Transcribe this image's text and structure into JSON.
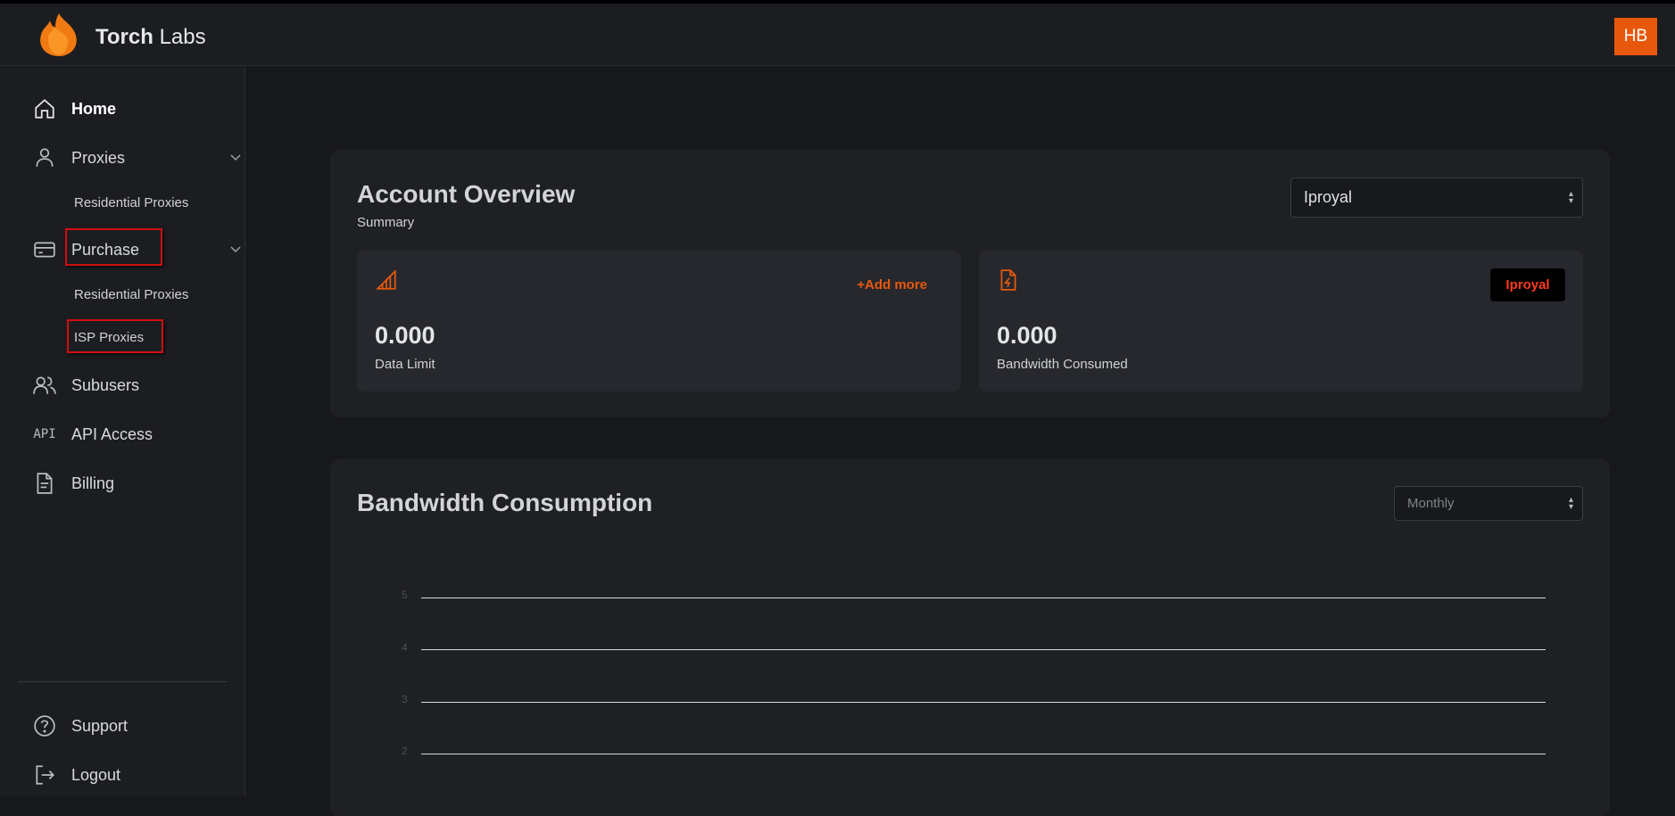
{
  "header": {
    "brand_bold": "Torch",
    "brand_light": "Labs",
    "avatar_initials": "HB",
    "accent_color": "#e8580c"
  },
  "sidebar": {
    "home": "Home",
    "proxies": "Proxies",
    "proxies_sub_residential": "Residential Proxies",
    "purchase": "Purchase",
    "purchase_sub_residential": "Residential Proxies",
    "purchase_sub_isp": "ISP Proxies",
    "subusers": "Subusers",
    "api_icon_text": "API",
    "api_access": "API Access",
    "billing": "Billing",
    "support": "Support",
    "logout": "Logout"
  },
  "overview": {
    "title": "Account Overview",
    "subtitle": "Summary",
    "provider_select": "Iproyal",
    "data_limit": {
      "value": "0.000",
      "caption": "Data Limit",
      "action": "+Add more"
    },
    "bandwidth": {
      "value": "0.000",
      "caption": "Bandwidth Consumed",
      "badge": "Iproyal"
    }
  },
  "consumption": {
    "title": "Bandwidth Consumption",
    "period_select": "Monthly"
  },
  "chart_data": {
    "type": "line",
    "title": "Bandwidth Consumption",
    "y_ticks": [
      "5",
      "4",
      "3",
      "2"
    ],
    "series": [],
    "grid": true
  }
}
